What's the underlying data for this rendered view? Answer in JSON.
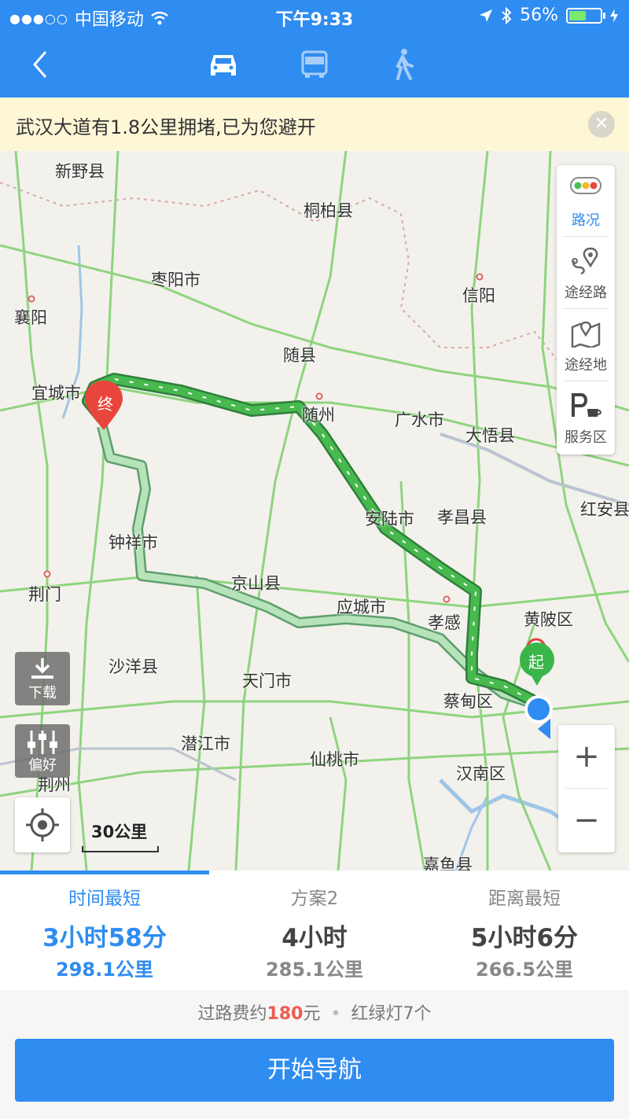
{
  "status_bar": {
    "signal": "●●●○○",
    "carrier": "中国移动",
    "time": "下午9:33",
    "battery": "56%",
    "battery_level": 0.56
  },
  "nav": {
    "back_icon": "chevron-left-icon",
    "modes": [
      "car-icon",
      "bus-icon",
      "walk-icon"
    ],
    "active_mode": "car"
  },
  "notice": {
    "text": "武汉大道有1.8公里拥堵,已为您避开",
    "close_icon": "close-icon"
  },
  "map": {
    "places": [
      {
        "name": "新野县"
      },
      {
        "name": "桐柏县"
      },
      {
        "name": "枣阳市"
      },
      {
        "name": "信阳"
      },
      {
        "name": "襄阳"
      },
      {
        "name": "随县"
      },
      {
        "name": "宜城市"
      },
      {
        "name": "随州"
      },
      {
        "name": "广水市"
      },
      {
        "name": "大悟县"
      },
      {
        "name": "安陆市"
      },
      {
        "name": "孝昌县"
      },
      {
        "name": "红安县"
      },
      {
        "name": "钟祥市"
      },
      {
        "name": "京山县"
      },
      {
        "name": "荆门"
      },
      {
        "name": "应城市"
      },
      {
        "name": "孝感"
      },
      {
        "name": "黄陂区"
      },
      {
        "name": "沙洋县"
      },
      {
        "name": "天门市"
      },
      {
        "name": "蔡甸区"
      },
      {
        "name": "潜江市"
      },
      {
        "name": "仙桃市"
      },
      {
        "name": "汉南区"
      },
      {
        "name": "荆州"
      },
      {
        "name": "嘉鱼县"
      }
    ],
    "markers": {
      "end": "终",
      "start": "起"
    },
    "side_panel": [
      {
        "icon": "traffic-light-icon",
        "label": "路况"
      },
      {
        "icon": "waypoint-route-icon",
        "label": "途经路"
      },
      {
        "icon": "waypoint-map-icon",
        "label": "途经地"
      },
      {
        "icon": "service-area-icon",
        "label": "服务区"
      }
    ],
    "download_label": "下载",
    "preference_label": "偏好",
    "scale": "30公里",
    "zoom_in": "+",
    "zoom_out": "−"
  },
  "routes": [
    {
      "name": "时间最短",
      "time": "3小时58分",
      "distance": "298.1公里",
      "active": true
    },
    {
      "name": "方案2",
      "time": "4小时",
      "distance": "285.1公里",
      "active": false
    },
    {
      "name": "距离最短",
      "time": "5小时6分",
      "distance": "266.5公里",
      "active": false
    }
  ],
  "summary": {
    "toll_prefix": "过路费约",
    "toll_value": "180",
    "toll_unit": "元",
    "separator": "•",
    "lights": "红绿灯7个"
  },
  "start_button": "开始导航",
  "colors": {
    "accent": "#2f8cf0",
    "notice_bg": "#fdf7d6",
    "route_main": "#3aa14d",
    "route_alt": "#a8dcae",
    "marker_end": "#e8463c",
    "marker_start": "#3ab54a"
  }
}
